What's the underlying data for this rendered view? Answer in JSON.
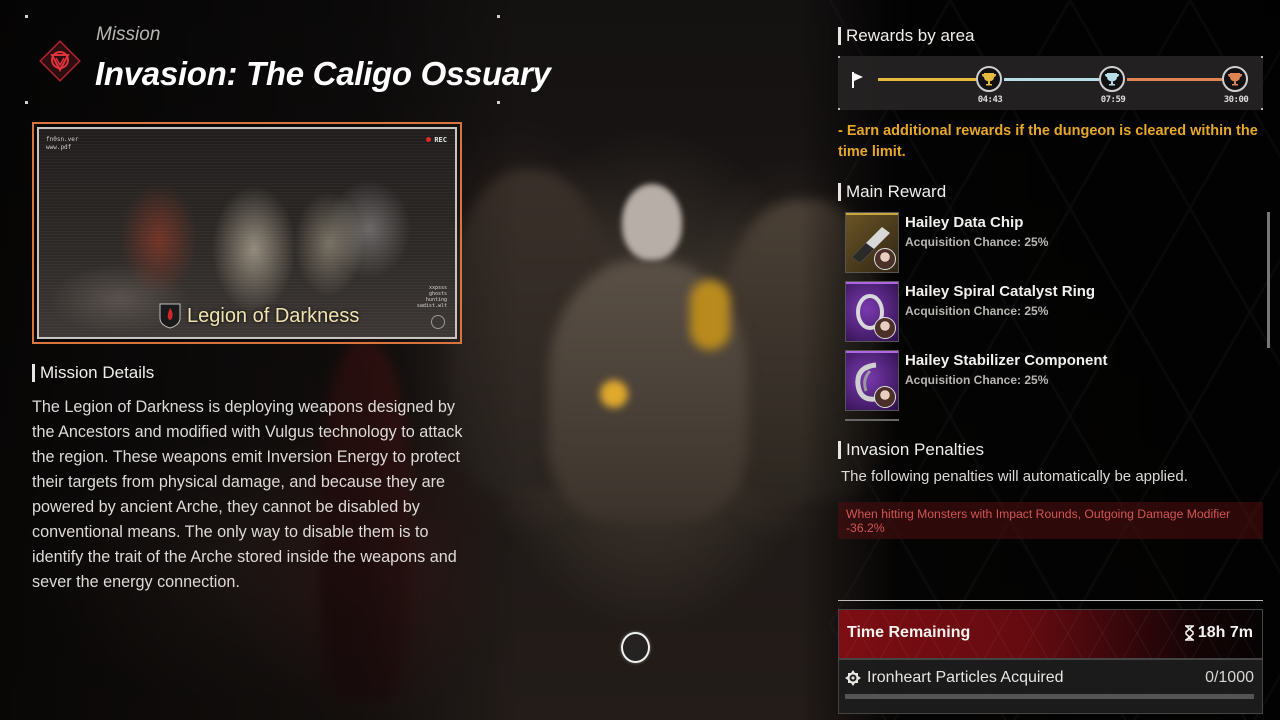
{
  "header": {
    "mission_label": "Mission",
    "mission_title": "Invasion: The Caligo Ossuary"
  },
  "preview": {
    "overlay_top_left": [
      "fn0sn.ver",
      "www.pdf"
    ],
    "rec_label": "REC",
    "overlay_bottom_right": [
      "xxpsss",
      "ghosts",
      "hunting",
      "sadist.wlt"
    ],
    "faction_name": "Legion of Darkness"
  },
  "mission_details": {
    "heading": "Mission Details",
    "body": "The Legion of Darkness is deploying weapons designed by the Ancestors and modified with Vulgus technology to attack the region. These weapons emit Inversion Energy to protect their targets from physical damage, and because they are powered by ancient Arche, they cannot be disabled by conventional means. The only way to disable them is to identify the trait of the Arche stored inside the weapons and sever the energy connection."
  },
  "rewards_by_area": {
    "heading": "Rewards by area",
    "tiers": [
      {
        "rank": "1",
        "time": "04:43",
        "color": "#e6b93f",
        "icon": "gold-trophy-icon"
      },
      {
        "rank": "2",
        "time": "07:59",
        "color": "#b9dde6",
        "icon": "silver-trophy-icon"
      },
      {
        "rank": "3",
        "time": "30:00",
        "color": "#e08552",
        "icon": "bronze-trophy-icon"
      }
    ],
    "note": "- Earn additional rewards if the dungeon is cleared within the time limit."
  },
  "main_reward": {
    "heading": "Main Reward",
    "items": [
      {
        "name": "Hailey Data Chip",
        "chance": "Acquisition Chance: 25%",
        "rarity_color": "#c9a640",
        "bg": "gold"
      },
      {
        "name": "Hailey Spiral Catalyst Ring",
        "chance": "Acquisition Chance: 25%",
        "rarity_color": "#b066e0",
        "bg": "purple"
      },
      {
        "name": "Hailey Stabilizer Component",
        "chance": "Acquisition Chance: 25%",
        "rarity_color": "#b066e0",
        "bg": "purple"
      }
    ]
  },
  "penalties": {
    "heading": "Invasion Penalties",
    "description": "The following penalties will automatically be applied.",
    "items": [
      "When hitting Monsters with Impact Rounds, Outgoing Damage Modifier -36.2%"
    ]
  },
  "status": {
    "time_label": "Time Remaining",
    "time_value": "18h 7m",
    "particles_label": "Ironheart Particles Acquired",
    "particles_value": "0/1000",
    "particles_progress": 0
  },
  "colors": {
    "accent_orange": "#d8753f",
    "note_yellow": "#e7a82a",
    "penalty_red": "#d25555",
    "time_red": "#820e14"
  }
}
